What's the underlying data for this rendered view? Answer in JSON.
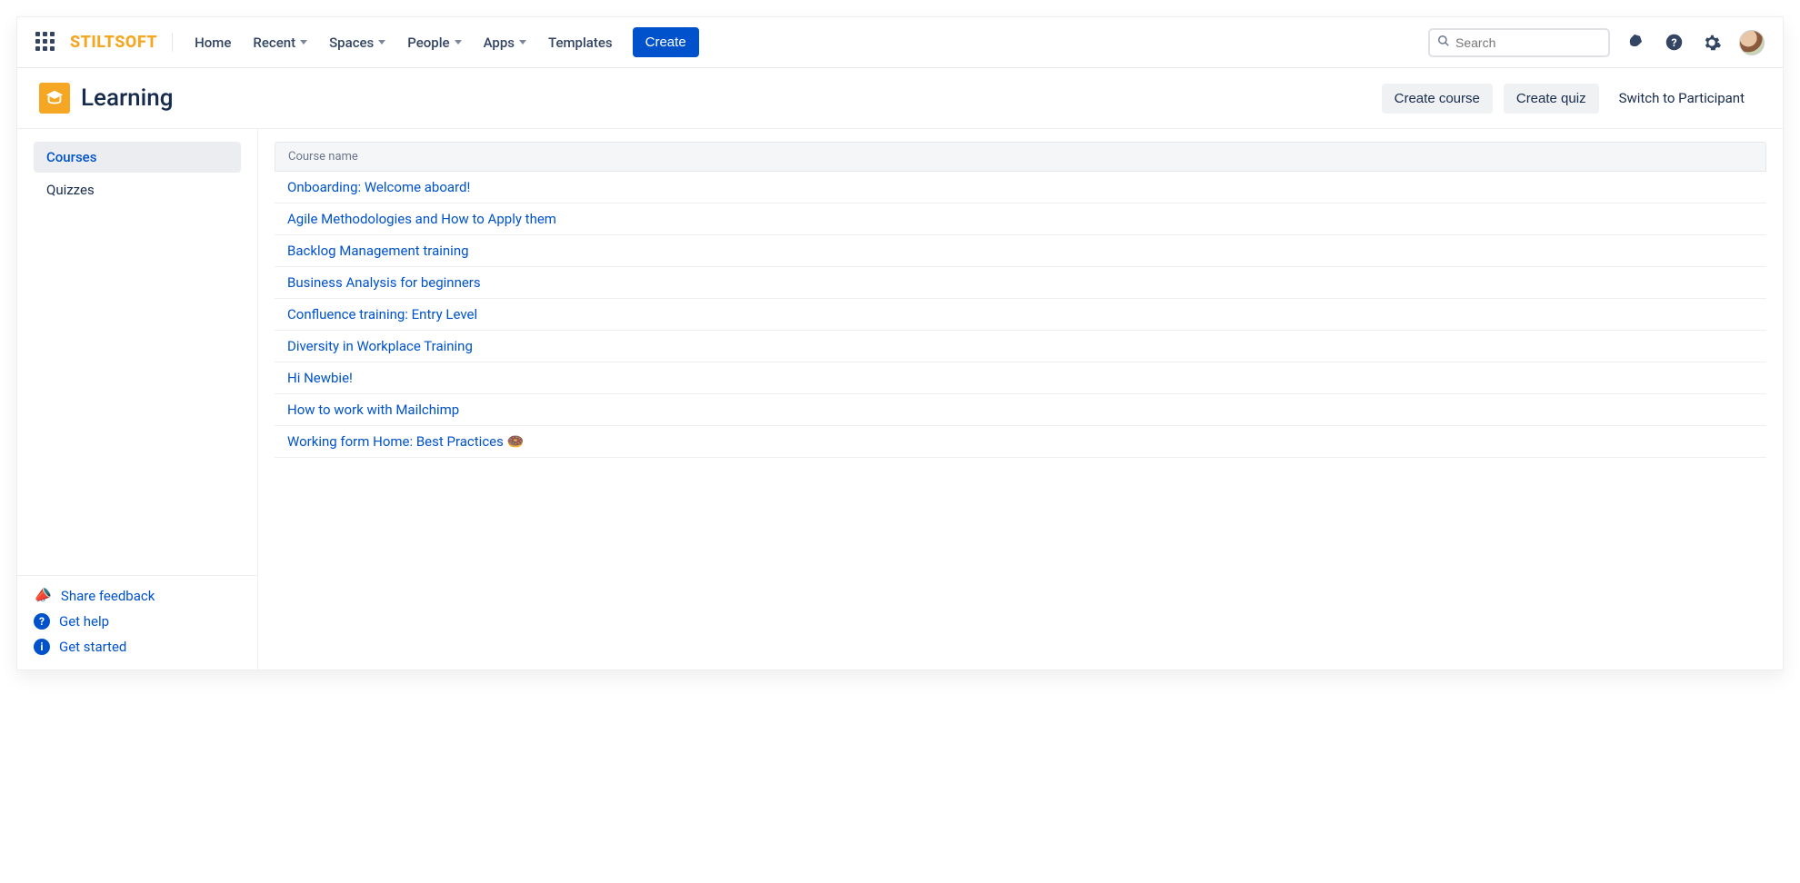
{
  "brand": "STILTSOFT",
  "nav": {
    "home": "Home",
    "recent": "Recent",
    "spaces": "Spaces",
    "people": "People",
    "apps": "Apps",
    "templates": "Templates",
    "create": "Create"
  },
  "search": {
    "placeholder": "Search"
  },
  "page": {
    "title": "Learning",
    "create_course": "Create course",
    "create_quiz": "Create quiz",
    "switch": "Switch to Participant"
  },
  "sidebar": {
    "items": [
      {
        "label": "Courses",
        "active": true
      },
      {
        "label": "Quizzes",
        "active": false
      }
    ],
    "feedback": "Share feedback",
    "help": "Get help",
    "getstarted": "Get started"
  },
  "table": {
    "header": "Course name",
    "rows": [
      "Onboarding: Welcome aboard!",
      "Agile Methodologies and How to Apply them",
      "Backlog Management training",
      "Business Analysis for beginners",
      "Confluence training: Entry Level",
      "Diversity in Workplace Training",
      "Hi Newbie!",
      "How to work with Mailchimp",
      "Working form Home: Best Practices 🍩"
    ]
  }
}
